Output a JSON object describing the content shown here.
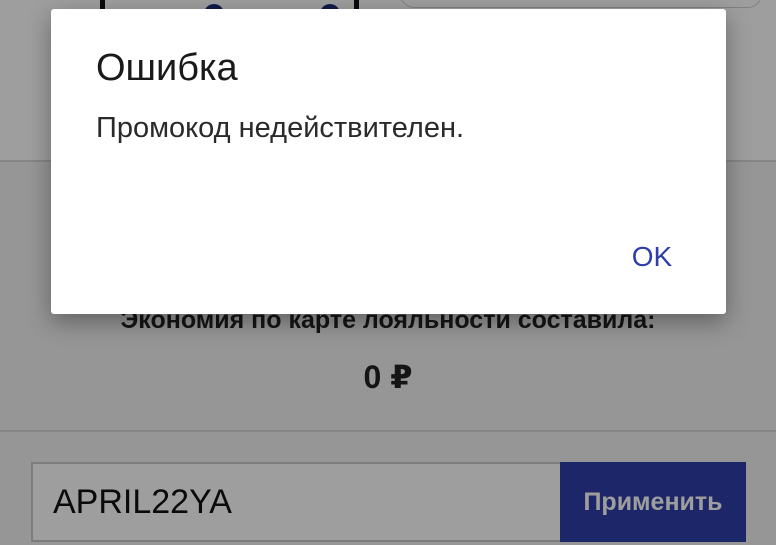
{
  "background": {
    "savings_label": "Экономия по карте лояльности составила:",
    "savings_value": "0 ₽",
    "promo_input_value": "APRIL22YA",
    "apply_label": "Применить"
  },
  "dialog": {
    "title": "Ошибка",
    "message": "Промокод недействителен.",
    "ok_label": "OK"
  },
  "colors": {
    "accent": "#2f3ea8",
    "scrim": "rgba(0,0,0,0.38)"
  }
}
